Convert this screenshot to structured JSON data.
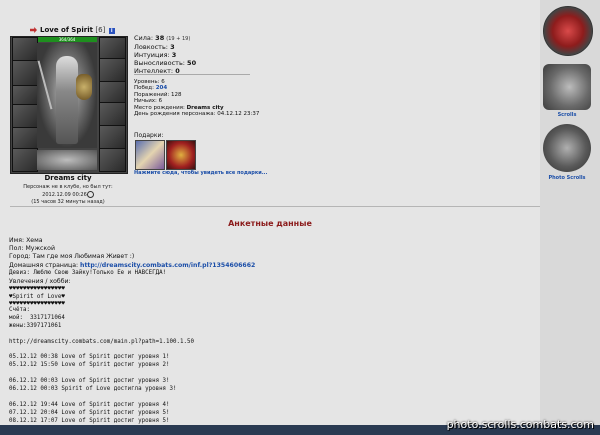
{
  "character": {
    "name": "Love of Spirit",
    "level": "[6]",
    "hp": "364/364",
    "city": "Dreams city",
    "offline_line1": "Персонаж не в клубе, но был тут:",
    "offline_line2": "2012.12.09 00:26",
    "offline_line3": "(15 часов 32 минуты назад)"
  },
  "stats": {
    "strength_label": "Сила:",
    "strength_value": "38",
    "strength_extra": "(19 + 19)",
    "agility_label": "Ловкость:",
    "agility_value": "3",
    "intuition_label": "Интуиция:",
    "intuition_value": "3",
    "endurance_label": "Выносливость:",
    "endurance_value": "50",
    "intellect_label": "Интеллект:",
    "intellect_value": "0"
  },
  "info": {
    "level": "Уровень: 6",
    "wins_label": "Побед:",
    "wins_value": "204",
    "losses": "Поражений: 128",
    "draws": "Ничьих: 6",
    "birthplace_label": "Место рождения:",
    "birthplace_value": "Dreams city",
    "birthday": "День рождения персонажа: 04.12.12 23:37"
  },
  "gifts": {
    "label": "Подарки:",
    "hint": "Нажмите сюда, чтобы увидеть все подарки..."
  },
  "section_title": "Анкетные данные",
  "profile": {
    "name": "Имя: Хема",
    "gender": "Пол: Мужской",
    "city": "Город: Там где моя Любимая Живет :)",
    "homepage_label": "Домашняя страница:",
    "homepage_url": "http://dreamscity.combats.com/inf.pl?1354606662",
    "motto": "Девиз: Люблю Свою Зайку!Только Ее и НАВСЕГДА!",
    "hobbies_label": "Увлечения / хобби:",
    "hearts1": "♥♥♥♥♥♥♥♥♥♥♥♥♥♥♥♥",
    "spirit_line": "♥Spirit of Love♥",
    "hearts2": "♥♥♥♥♥♥♥♥♥♥♥♥♥♥♥♥"
  },
  "log_lines": [
    "Счёта:",
    "мой:  3317171064",
    "жены:3397171061",
    "",
    "http://dreamscity.combats.com/main.pl?path=1.100.1.50",
    "",
    "05.12.12 00:38 Love of Spirit достиг уровня 1!",
    "05.12.12 15:50 Love of Spirit достиг уровня 2!",
    "",
    "06.12.12 00:03 Love of Spirit достиг уровня 3!",
    "06.12.12 00:03 Spirit of Love достигла уровня 3!",
    "",
    "06.12.12 19:44 Love of Spirit достиг уровня 4!",
    "07.12.12 20:04 Love of Spirit достиг уровня 5!",
    "08.12.12 17:07 Love of Spirit достиг уровня 5!"
  ],
  "sidebar": {
    "scrolls_label": "Scrolls",
    "photo_label": "Photo Scrolls"
  },
  "watermark": "photo.scrolls.combats.com",
  "icons": [
    "arrow-icon",
    "info-icon",
    "clock-icon",
    "fist-icon",
    "scroll-icon",
    "camera-icon"
  ]
}
